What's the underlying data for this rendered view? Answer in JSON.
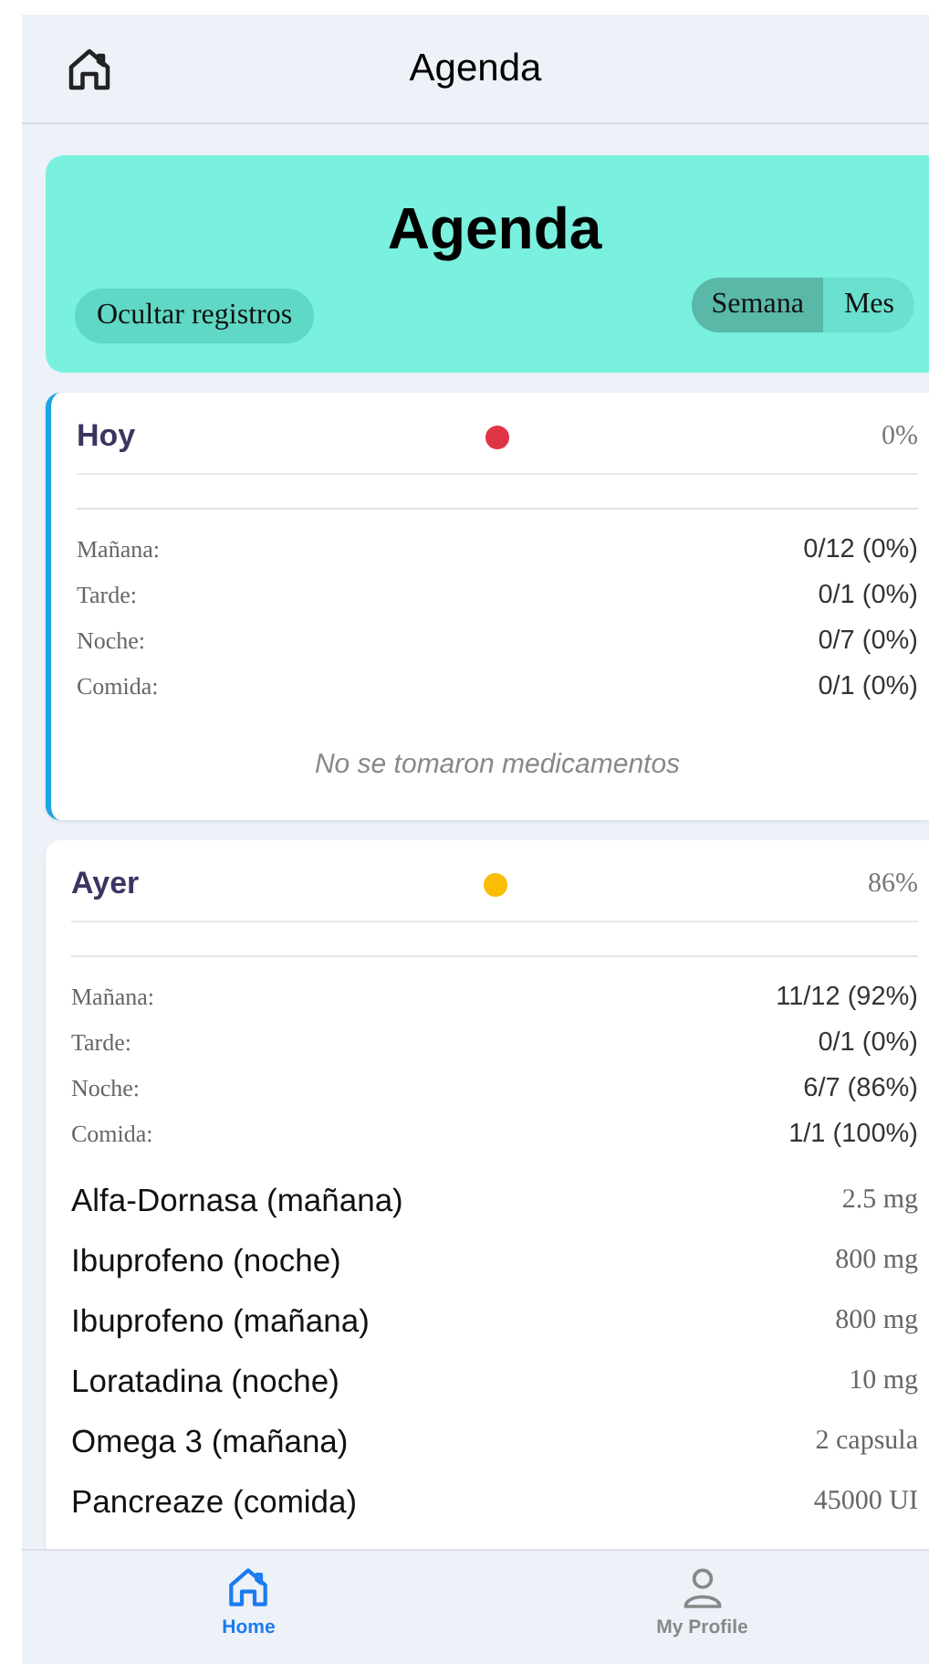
{
  "header": {
    "title": "Agenda"
  },
  "hero": {
    "title": "Agenda",
    "hide_button": "Ocultar registros",
    "ranges": [
      {
        "label": "Semana",
        "selected": true
      },
      {
        "label": "Mes",
        "selected": false
      }
    ]
  },
  "days": [
    {
      "title": "Hoy",
      "highlighted": true,
      "color": "#e03444",
      "percent": "0%",
      "periods": [
        {
          "label": "Mañana:",
          "value": "0/12 (0%)"
        },
        {
          "label": "Tarde:",
          "value": "0/1 (0%)"
        },
        {
          "label": "Noche:",
          "value": "0/7 (0%)"
        },
        {
          "label": "Comida:",
          "value": "0/1 (0%)"
        }
      ],
      "empty_message": "No se tomaron medicamentos"
    },
    {
      "title": "Ayer",
      "highlighted": false,
      "color": "#fbbc05",
      "percent": "86%",
      "periods": [
        {
          "label": "Mañana:",
          "value": "11/12 (92%)"
        },
        {
          "label": "Tarde:",
          "value": "0/1 (0%)"
        },
        {
          "label": "Noche:",
          "value": "6/7 (86%)"
        },
        {
          "label": "Comida:",
          "value": "1/1 (100%)"
        }
      ],
      "medications": [
        {
          "name": "Alfa-Dornasa (mañana)",
          "dose": "2.5 mg"
        },
        {
          "name": "Ibuprofeno (noche)",
          "dose": "800 mg"
        },
        {
          "name": "Ibuprofeno (mañana)",
          "dose": "800 mg"
        },
        {
          "name": "Loratadina (noche)",
          "dose": "10 mg"
        },
        {
          "name": "Omega 3 (mañana)",
          "dose": "2 capsula"
        },
        {
          "name": "Pancreaze (comida)",
          "dose": "45000 UI"
        }
      ]
    }
  ],
  "nav": [
    {
      "label": "Home",
      "kind": "home",
      "selected": true
    },
    {
      "label": "My Profile",
      "kind": "profile",
      "selected": false
    }
  ]
}
